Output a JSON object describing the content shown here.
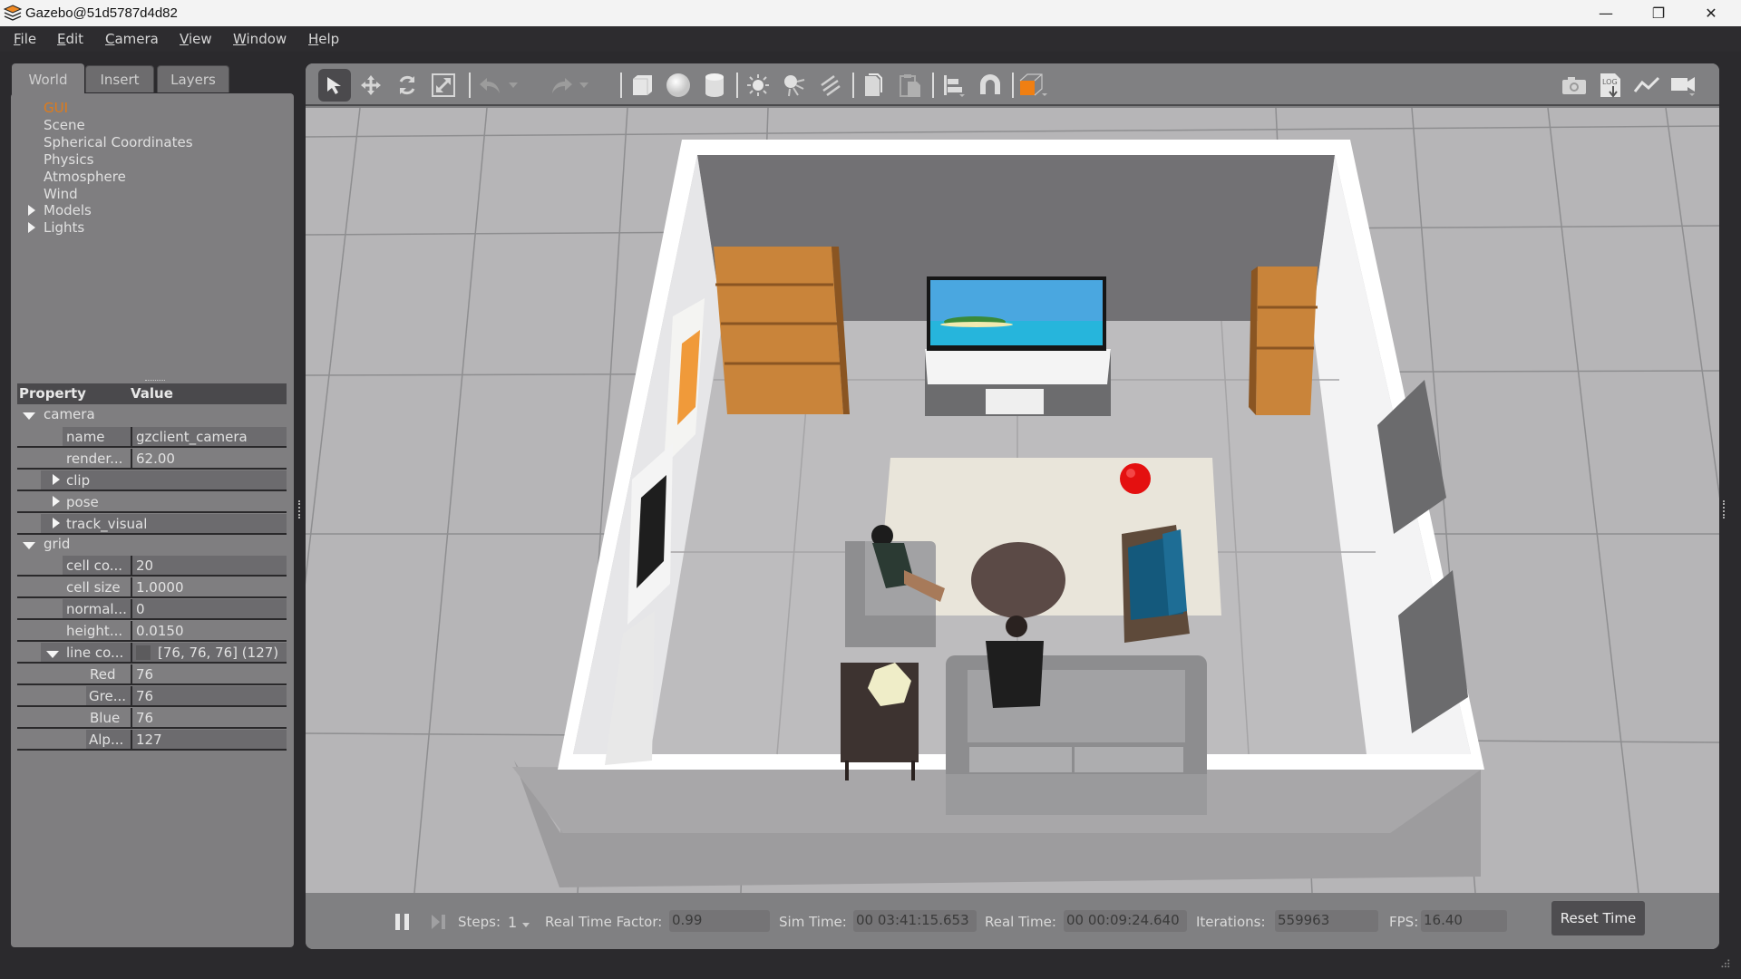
{
  "window": {
    "title": "Gazebo@51d5787d4d82",
    "controls": {
      "minimize": "—",
      "restore": "❐",
      "close": "✕"
    }
  },
  "menu": [
    {
      "label": "File",
      "mnemonic": "F",
      "rest": "ile"
    },
    {
      "label": "Edit",
      "mnemonic": "E",
      "rest": "dit"
    },
    {
      "label": "Camera",
      "mnemonic": "C",
      "rest": "amera"
    },
    {
      "label": "View",
      "mnemonic": "V",
      "rest": "iew"
    },
    {
      "label": "Window",
      "mnemonic": "W",
      "rest": "indow"
    },
    {
      "label": "Help",
      "mnemonic": "H",
      "rest": "elp"
    }
  ],
  "left_panel": {
    "tabs": [
      {
        "label": "World",
        "active": true
      },
      {
        "label": "Insert",
        "active": false
      },
      {
        "label": "Layers",
        "active": false
      }
    ],
    "tree": [
      {
        "label": "GUI",
        "selected": true,
        "expandable": false
      },
      {
        "label": "Scene",
        "selected": false,
        "expandable": false
      },
      {
        "label": "Spherical Coordinates",
        "selected": false,
        "expandable": false
      },
      {
        "label": "Physics",
        "selected": false,
        "expandable": false
      },
      {
        "label": "Atmosphere",
        "selected": false,
        "expandable": false
      },
      {
        "label": "Wind",
        "selected": false,
        "expandable": false
      },
      {
        "label": "Models",
        "selected": false,
        "expandable": true
      },
      {
        "label": "Lights",
        "selected": false,
        "expandable": true
      }
    ],
    "properties": {
      "header": {
        "property": "Property",
        "value": "Value"
      },
      "groups": {
        "camera": "camera",
        "grid": "grid"
      },
      "camera_rows": [
        {
          "name": "name",
          "value": "gzclient_camera"
        },
        {
          "name": "render...",
          "value": "62.00"
        }
      ],
      "camera_subgroups": [
        "clip",
        "pose",
        "track_visual"
      ],
      "grid_rows": [
        {
          "name": "cell co...",
          "value": "20"
        },
        {
          "name": "cell size",
          "value": "1.0000"
        },
        {
          "name": "normal...",
          "value": "0"
        },
        {
          "name": "height...",
          "value": "0.0150"
        }
      ],
      "line_color": {
        "name": "line co...",
        "value": "[76, 76, 76] (127)",
        "swatch": "#4c4c4c"
      },
      "line_color_rows": [
        {
          "name": "Red",
          "value": "76"
        },
        {
          "name": "Gre...",
          "value": "76"
        },
        {
          "name": "Blue",
          "value": "76"
        },
        {
          "name": "Alp...",
          "value": "127"
        }
      ]
    }
  },
  "toolbar": {
    "tools": [
      {
        "icon": "select-arrow-icon",
        "active": true
      },
      {
        "icon": "translate-icon"
      },
      {
        "icon": "rotate-icon"
      },
      {
        "icon": "scale-icon"
      },
      {
        "icon": "undo-icon"
      },
      {
        "icon": "undo-history-dropdown-icon"
      },
      {
        "icon": "redo-icon"
      },
      {
        "icon": "redo-history-dropdown-icon"
      },
      {
        "icon": "box-shape-icon"
      },
      {
        "icon": "sphere-shape-icon"
      },
      {
        "icon": "cylinder-shape-icon"
      },
      {
        "icon": "point-light-icon"
      },
      {
        "icon": "spot-light-icon"
      },
      {
        "icon": "directional-light-icon"
      },
      {
        "icon": "copy-icon"
      },
      {
        "icon": "paste-icon"
      },
      {
        "icon": "align-icon"
      },
      {
        "icon": "snap-magnet-icon"
      },
      {
        "icon": "view-angle-icon"
      }
    ],
    "right_tools": [
      {
        "icon": "screenshot-camera-icon"
      },
      {
        "icon": "log-download-icon",
        "text": "LOG"
      },
      {
        "icon": "plot-icon"
      },
      {
        "icon": "video-record-icon"
      }
    ]
  },
  "scene": {
    "colors": {
      "ground": "#b4b3b5",
      "wall_top": "#ffffff",
      "wall_inner": "#6f6f71",
      "floor": "#bdbdbf",
      "shelf": "#d08a3c",
      "rug": "#e9e5da",
      "sofa": "#8a8a8c",
      "armchair_blue": "#15577a",
      "ball": "#e01010",
      "table": "#4a3b38"
    }
  },
  "bottom_bar": {
    "steps_label": "Steps:",
    "steps_value": "1",
    "rtf_label": "Real Time Factor:",
    "rtf_value": "0.99",
    "sim_time_label": "Sim Time:",
    "sim_time_value": "00 03:41:15.653",
    "real_time_label": "Real Time:",
    "real_time_value": "00 00:09:24.640",
    "iterations_label": "Iterations:",
    "iterations_value": "559963",
    "fps_label": "FPS:",
    "fps_value": "16.40",
    "reset_label": "Reset Time"
  }
}
